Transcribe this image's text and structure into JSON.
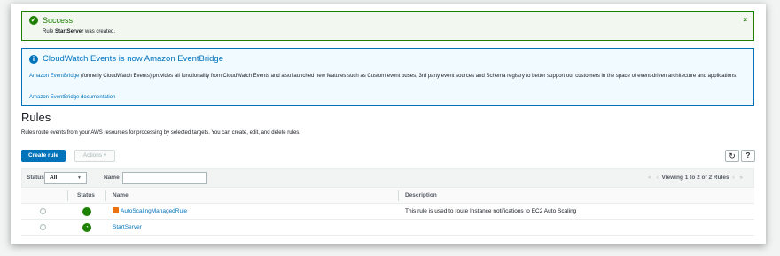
{
  "colors": {
    "success": "#1d8102",
    "info": "#0073bb",
    "primary": "#0073bb"
  },
  "success_flash": {
    "title": "Success",
    "message_prefix": "Rule ",
    "rule_name": "StartServer",
    "message_suffix": " was created.",
    "icon": "check-circle-icon",
    "close_glyph": "×"
  },
  "info_flash": {
    "title": "CloudWatch Events is now Amazon EventBridge",
    "icon": "info-circle-icon",
    "link_text": "Amazon EventBridge",
    "body": " (formerly CloudWatch Events) provides all functionality from CloudWatch Events and also launched new features such as Custom event buses, 3rd party event sources and Schema registry to better support our customers in the space of event-driven architecture and applications.",
    "doc_link": "Amazon EventBridge documentation"
  },
  "page": {
    "title": "Rules",
    "description": "Rules route events from your AWS resources for processing by selected targets. You can create, edit, and delete rules."
  },
  "toolbar": {
    "create_label": "Create rule",
    "actions_label": "Actions ▾",
    "refresh_glyph": "↻",
    "help_glyph": "?"
  },
  "filter": {
    "status_label": "Status",
    "status_value": "All",
    "name_label": "Name",
    "name_value": "",
    "pager_first": "«",
    "pager_prev": "‹",
    "pager_text": "Viewing 1 to 2 of 2 Rules",
    "pager_next": "›",
    "pager_last": "»"
  },
  "table": {
    "columns": [
      "Status",
      "Name",
      "Description"
    ],
    "rows": [
      {
        "name": "AutoScalingManagedRule",
        "description": "This rule is used to route Instance notifications to EC2 Auto Scaling",
        "status_glyph": ""
      },
      {
        "name": "StartServer",
        "description": "",
        "status_glyph": "◔"
      }
    ]
  }
}
